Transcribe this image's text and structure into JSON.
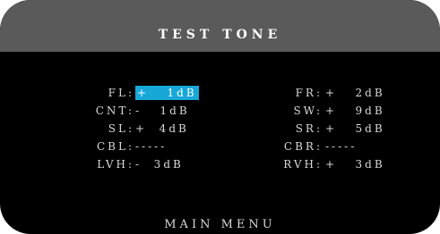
{
  "title": "TEST TONE",
  "left_channels": [
    {
      "label": "FL:",
      "value": "+   1dB",
      "selected": true
    },
    {
      "label": "CNT:",
      "value": "-   1dB",
      "selected": false
    },
    {
      "label": "SL:",
      "value": "+  4dB",
      "selected": false
    },
    {
      "label": "CBL:",
      "value": "-----",
      "selected": false
    },
    {
      "label": "LVH:",
      "value": "-  3dB",
      "selected": false
    }
  ],
  "right_channels": [
    {
      "label": "FR:",
      "value": "+   2dB",
      "selected": false
    },
    {
      "label": "SW:",
      "value": "+   9dB",
      "selected": false
    },
    {
      "label": "SR:",
      "value": "+   5dB",
      "selected": false
    },
    {
      "label": "CBR:",
      "value": "-----",
      "selected": false
    },
    {
      "label": "RVH:",
      "value": "+   3dB",
      "selected": false
    }
  ],
  "menu": {
    "main_menu": "MAIN MENU"
  },
  "colors": {
    "background": "#000000",
    "title_bar": "#5a5a5a",
    "text": "#d8d8d8",
    "highlight": "#18a8d8"
  }
}
